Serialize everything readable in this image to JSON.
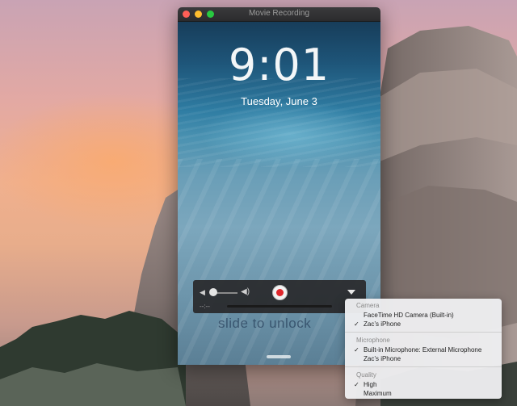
{
  "window": {
    "title": "Movie Recording"
  },
  "lock_screen": {
    "time": "9:01",
    "date": "Tuesday, June 3",
    "slide_text": "slide to unlock"
  },
  "controls": {
    "time": "--:--",
    "volume_icon_low": "speaker-low-icon",
    "volume_icon_high": "speaker-high-icon",
    "record_icon": "record-icon",
    "menu_icon": "chevron-down-icon"
  },
  "menu": {
    "camera_header": "Camera",
    "camera_items": [
      {
        "label": "FaceTime HD Camera (Built-in)",
        "checked": false
      },
      {
        "label": "Zac’s iPhone",
        "checked": true
      }
    ],
    "microphone_header": "Microphone",
    "microphone_items": [
      {
        "label": "Built-in Microphone: External Microphone",
        "checked": true
      },
      {
        "label": "Zac’s iPhone",
        "checked": false
      }
    ],
    "quality_header": "Quality",
    "quality_items": [
      {
        "label": "High",
        "checked": true
      },
      {
        "label": "Maximum",
        "checked": false
      }
    ],
    "check_mark": "✓"
  },
  "colors": {
    "record_red": "#e0262b",
    "close": "#ff5f57",
    "minimize": "#ffbd2e",
    "maximize": "#28c940"
  }
}
